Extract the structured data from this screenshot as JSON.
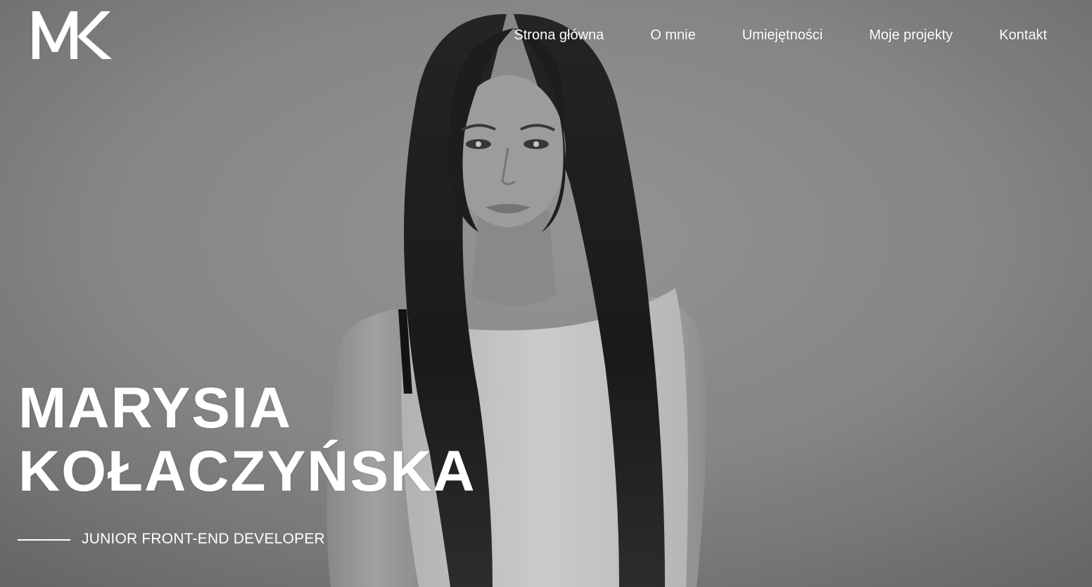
{
  "header": {
    "logo_text": "MK",
    "nav": [
      {
        "label": "Strona główna"
      },
      {
        "label": "O mnie"
      },
      {
        "label": "Umiejętności"
      },
      {
        "label": "Moje projekty"
      },
      {
        "label": "Kontakt"
      }
    ]
  },
  "hero": {
    "name_line1": "MARYSIA",
    "name_line2": "KOŁACZYŃSKA",
    "role": "JUNIOR FRONT-END DEVELOPER",
    "photo_description_icon": "portrait-photo"
  },
  "colors": {
    "text": "#ffffff",
    "background": "#8a8a8a"
  }
}
